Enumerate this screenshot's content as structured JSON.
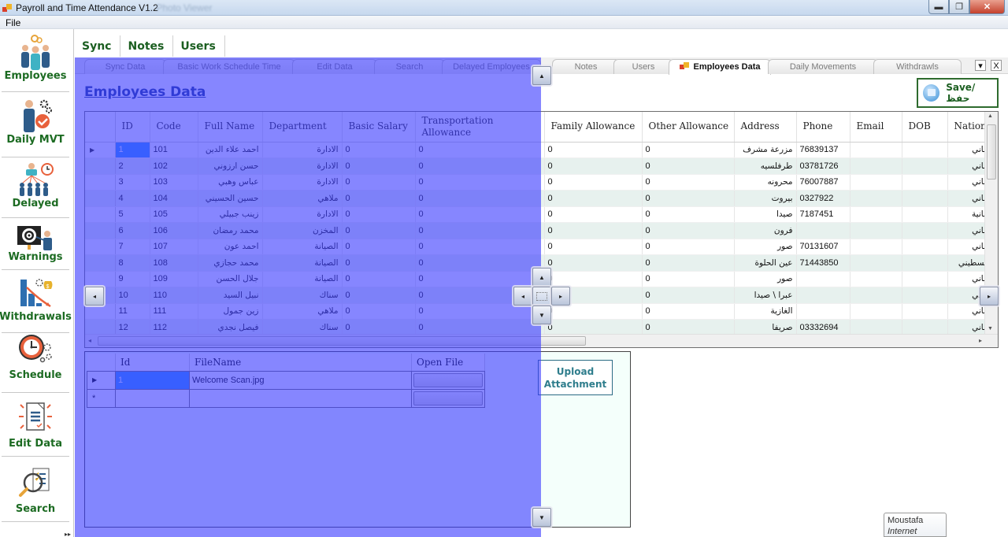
{
  "window": {
    "title": "Payroll and Time Attendance V1.2",
    "ghost_title": "... Photo Viewer",
    "controls": [
      "minimize",
      "restore",
      "close"
    ]
  },
  "menu": {
    "items": [
      {
        "label": "File"
      }
    ]
  },
  "sidebar": {
    "items": [
      {
        "label": "Employees",
        "icon": "employees-icon"
      },
      {
        "label": "Daily MVT",
        "icon": "daily-movement-icon"
      },
      {
        "label": "Delayed",
        "icon": "delayed-icon"
      },
      {
        "label": "Warnings",
        "icon": "warnings-icon"
      },
      {
        "label": "Withdrawals",
        "icon": "withdrawals-icon"
      },
      {
        "label": "Schedule",
        "icon": "schedule-icon"
      },
      {
        "label": "Edit Data",
        "icon": "edit-data-icon"
      },
      {
        "label": "Search",
        "icon": "search-icon"
      }
    ]
  },
  "top_tabs": [
    {
      "label": "Sync"
    },
    {
      "label": "Notes"
    },
    {
      "label": "Users"
    }
  ],
  "doc_tabs": [
    {
      "label": "Sync Data",
      "active": false
    },
    {
      "label": "Basic Work Schedule Time",
      "active": false
    },
    {
      "label": "Edit Data",
      "active": false
    },
    {
      "label": "Search",
      "active": false
    },
    {
      "label": "Delayed Employees",
      "active": false
    },
    {
      "label": "Notes",
      "active": false
    },
    {
      "label": "Users",
      "active": false
    },
    {
      "label": "Employees Data",
      "active": true
    },
    {
      "label": "Daily Movements",
      "active": false
    },
    {
      "label": "Withdrawls",
      "active": false
    }
  ],
  "doc_tab_controls": {
    "dropdown": "▾",
    "close": "X"
  },
  "page": {
    "title": "Employees Data",
    "save_label": "Save/حفظ"
  },
  "employees_grid": {
    "columns": [
      "ID",
      "Code",
      "Full Name",
      "Department",
      "Basic Salary",
      "Transportation Allowance",
      "Family Allowance",
      "Other Allowance",
      "Address",
      "Phone",
      "Email",
      "DOB",
      "Nation"
    ],
    "selected_row": 0,
    "rows": [
      [
        "1",
        "101",
        "احمد علاء الدين",
        "الادارة",
        "0",
        "0",
        "0",
        "0",
        "مزرعة مشرف",
        "76839137",
        "",
        "",
        "لبناني"
      ],
      [
        "2",
        "102",
        "حسن ارزوني",
        "الادارة",
        "0",
        "0",
        "0",
        "0",
        "طرفلسيه",
        "03781726",
        "",
        "",
        "لبناني"
      ],
      [
        "3",
        "103",
        "عباس وهبي",
        "الادارة",
        "0",
        "0",
        "0",
        "0",
        "محرونه",
        "76007887",
        "",
        "",
        "لبناني"
      ],
      [
        "4",
        "104",
        "حسين الحسيني",
        "ملاهي",
        "0",
        "0",
        "0",
        "0",
        "بيروت",
        "0327922",
        "",
        "",
        "لبناني"
      ],
      [
        "5",
        "105",
        "زينب جبيلي",
        "الادارة",
        "0",
        "0",
        "0",
        "0",
        "صيدا",
        "7187451",
        "",
        "",
        "لبنانية"
      ],
      [
        "6",
        "106",
        "محمد رمضان",
        "المخزن",
        "0",
        "0",
        "0",
        "0",
        "فرون",
        "",
        "",
        "",
        "لبناني"
      ],
      [
        "7",
        "107",
        "احمد عون",
        "الصيانة",
        "0",
        "0",
        "0",
        "0",
        "صور",
        "70131607",
        "",
        "",
        "لبناني"
      ],
      [
        "8",
        "108",
        "محمد حجازي",
        "الصيانة",
        "0",
        "0",
        "0",
        "0",
        "عين الحلوة",
        "71443850",
        "",
        "",
        "فلسطيني"
      ],
      [
        "9",
        "109",
        "جلال الحسن",
        "الصيانة",
        "0",
        "0",
        "0",
        "0",
        "صور",
        "",
        "",
        "",
        "لبناني"
      ],
      [
        "10",
        "110",
        "نبيل السيد",
        "سناك",
        "0",
        "0",
        "0",
        "0",
        "عبرا \\ صيدا",
        "",
        "",
        "",
        "لبناني"
      ],
      [
        "11",
        "111",
        "زين جمول",
        "ملاهي",
        "0",
        "0",
        "0",
        "0",
        "الغازية",
        "",
        "",
        "",
        "لبناني"
      ],
      [
        "12",
        "112",
        "فيصل نجدي",
        "سناك",
        "0",
        "0",
        "0",
        "0",
        "صريفا",
        "03332694",
        "",
        "",
        "لبناني"
      ]
    ]
  },
  "attachments_grid": {
    "columns": [
      "Id",
      "FileName",
      "Open File"
    ],
    "rows": [
      {
        "id": "1",
        "filename": "Welcome Scan.jpg"
      }
    ],
    "new_row_marker": "*",
    "upload_label": "Upload Attachment"
  },
  "tooltip": {
    "title": "Moustafa",
    "subtitle": "Internet access"
  },
  "colors": {
    "sidebar_label": "#1c6b22",
    "page_title": "#1f3a93",
    "selection": "#3399ff",
    "alt_row": "#e7f1ee",
    "dock_overlay": "#5a5aff"
  }
}
